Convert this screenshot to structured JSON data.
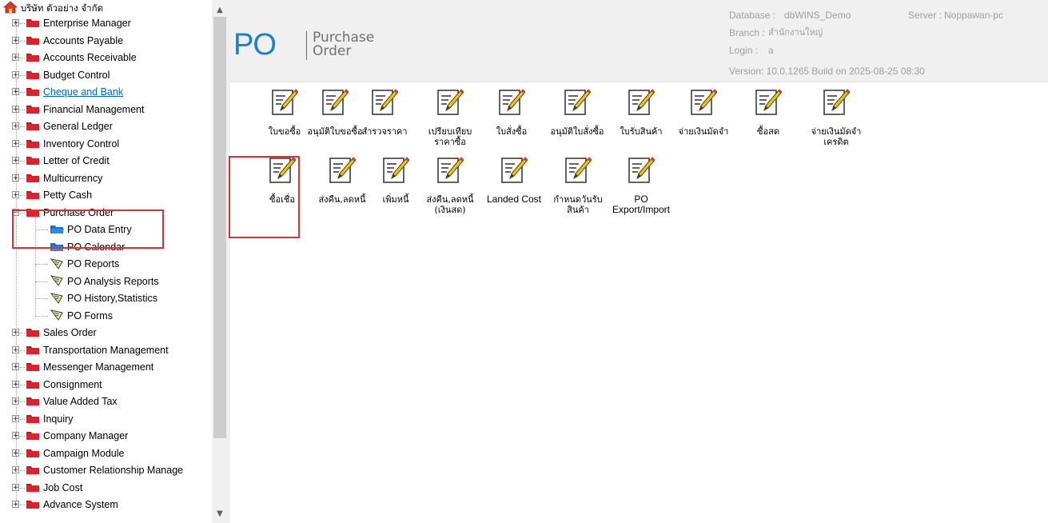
{
  "tree": {
    "root_label": "บริษัท ตัวอย่าง จำกัด",
    "items": [
      {
        "label": "Enterprise Manager",
        "type": "folder"
      },
      {
        "label": "Accounts Payable",
        "type": "folder"
      },
      {
        "label": "Accounts Receivable",
        "type": "folder"
      },
      {
        "label": "Budget Control",
        "type": "folder"
      },
      {
        "label": "Cheque and Bank",
        "type": "folder",
        "link": true
      },
      {
        "label": "Financial Management",
        "type": "folder"
      },
      {
        "label": "General Ledger",
        "type": "folder"
      },
      {
        "label": "Inventory Control",
        "type": "folder"
      },
      {
        "label": "Letter of Credit",
        "type": "folder"
      },
      {
        "label": "Multicurrency",
        "type": "folder"
      },
      {
        "label": "Petty Cash",
        "type": "folder"
      },
      {
        "label": "Purchase Order",
        "type": "folder",
        "expanded": true
      },
      {
        "label": "PO Data Entry",
        "type": "child-folder"
      },
      {
        "label": "PO Calendar",
        "type": "child-folder"
      },
      {
        "label": "PO Reports",
        "type": "child-report"
      },
      {
        "label": "PO Analysis Reports",
        "type": "child-report"
      },
      {
        "label": "PO History,Statistics",
        "type": "child-report"
      },
      {
        "label": "PO Forms",
        "type": "child-report"
      },
      {
        "label": "Sales Order",
        "type": "folder"
      },
      {
        "label": "Transportation Management",
        "type": "folder"
      },
      {
        "label": "Messenger Management",
        "type": "folder"
      },
      {
        "label": "Consignment",
        "type": "folder"
      },
      {
        "label": "Value Added Tax",
        "type": "folder"
      },
      {
        "label": "Inquiry",
        "type": "folder"
      },
      {
        "label": "Company Manager",
        "type": "folder"
      },
      {
        "label": "Campaign Module",
        "type": "folder"
      },
      {
        "label": "Customer Relationship Manage",
        "type": "folder"
      },
      {
        "label": "Job Cost",
        "type": "folder"
      },
      {
        "label": "Advance System",
        "type": "folder"
      }
    ]
  },
  "header": {
    "logo": "PO",
    "title_line1": "Purchase",
    "title_line2": "Order",
    "database_label": "Database :",
    "database_value": "dbWINS_Demo",
    "server_label": "Server :",
    "server_value": "Noppawan-pc",
    "branch_label": "Branch :",
    "branch_value": "สำนักงานใหญ่",
    "login_label": "Login :",
    "login_value": "a",
    "version_text": "Version: 10.0.1265  Build on 2025-08-25  08:30"
  },
  "tiles": [
    {
      "label": "ใบขอซื้อ"
    },
    {
      "label": "อนุมัติใบขอซื้อ"
    },
    {
      "label": "สำรวจราคา"
    },
    {
      "label": "เปรียบเทียบ\nราคาซื้อ"
    },
    {
      "label": "ใบสั่งซื้อ"
    },
    {
      "label": "อนุมัติใบสั่งซื้อ"
    },
    {
      "label": "ใบรับสินค้า"
    },
    {
      "label": "จ่ายเงินมัดจำ"
    },
    {
      "label": "ซื้อสด"
    },
    {
      "label": "จ่ายเงินมัดจำ\nเครดิต"
    },
    {
      "label": "ซื้อเชื่อ"
    },
    {
      "label": "ส่งคืน,ลดหนี้"
    },
    {
      "label": "เพิ่มหนี้"
    },
    {
      "label": "ส่งคืน,ลดหนี้\n(เงินสด)"
    },
    {
      "label": "Landed Cost"
    },
    {
      "label": "กำหนดวันรับ\nสินค้า"
    },
    {
      "label": "PO\nExport/Import"
    }
  ],
  "colors": {
    "accent": "#1e7fd0",
    "highlight": "#e03030",
    "folder_red": "#c8141e",
    "folder_blue": "#2a8fe0",
    "link": "#0066cc"
  }
}
